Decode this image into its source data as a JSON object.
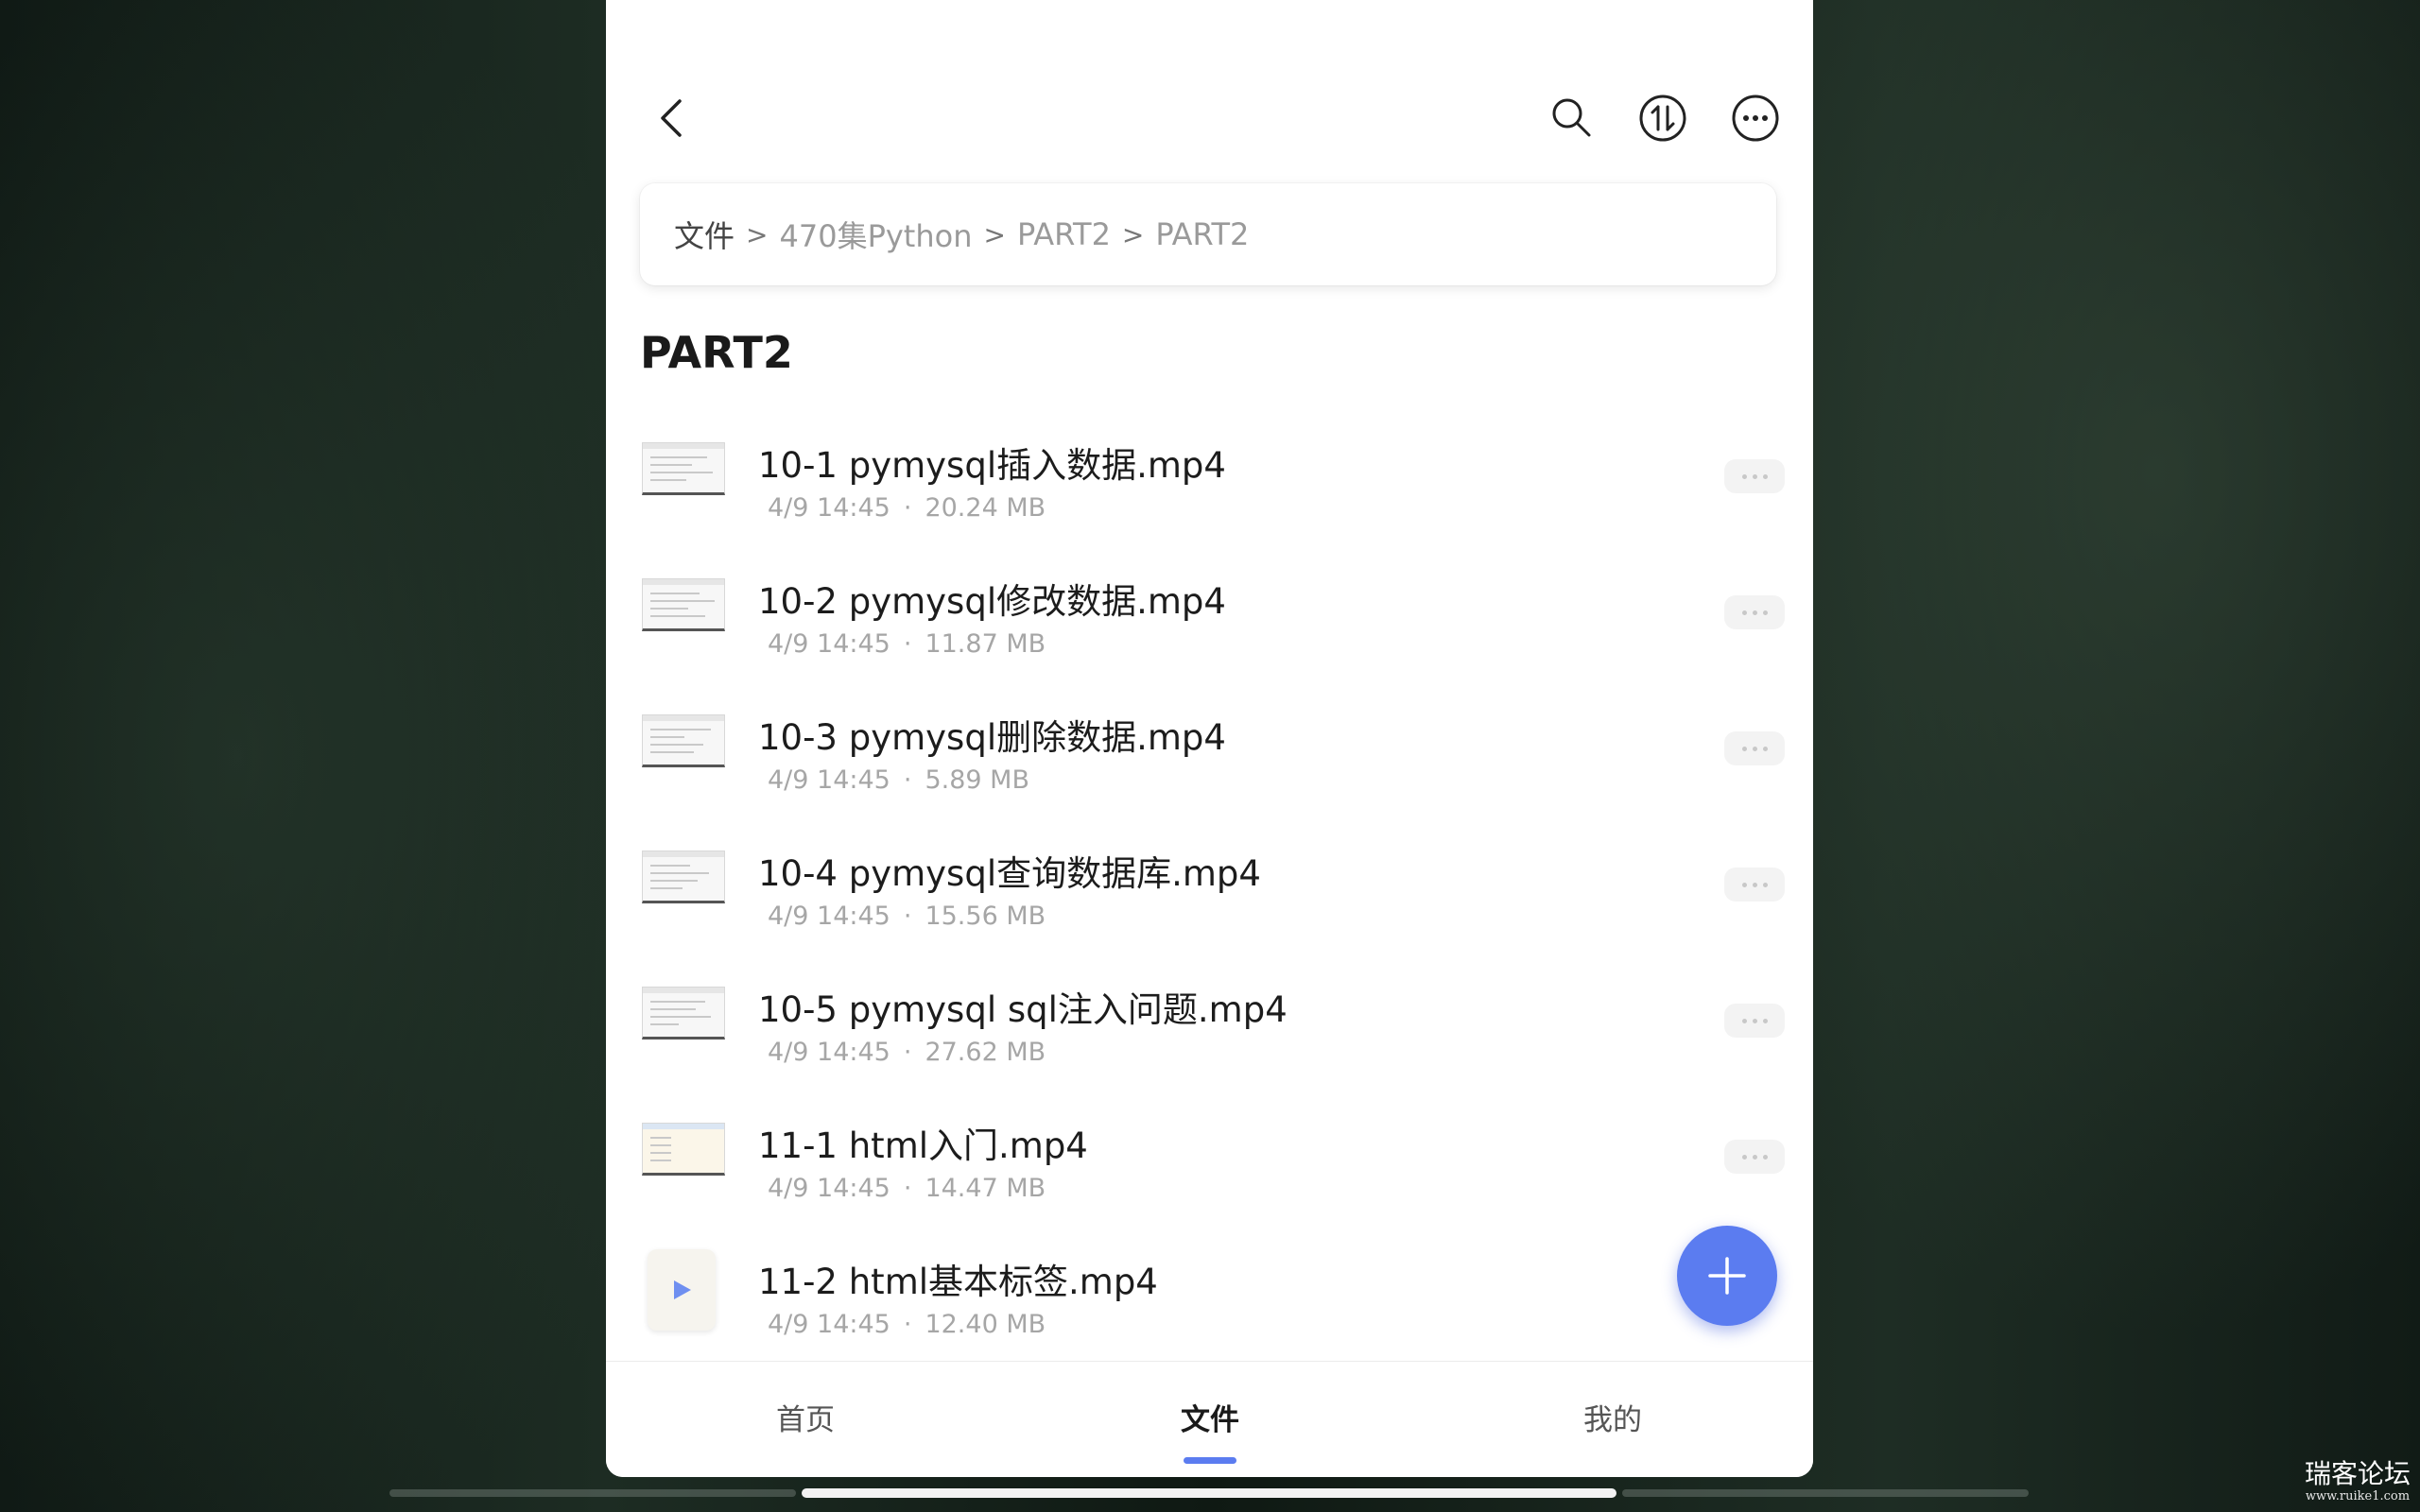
{
  "header": {
    "back_icon": "chevron-left-icon",
    "search_icon": "search-icon",
    "sort_icon": "sort-updown-icon",
    "more_icon": "more-horizontal-icon"
  },
  "breadcrumb": {
    "items": [
      "文件",
      "470集Python",
      "PART2",
      "PART2"
    ],
    "separator": ">"
  },
  "page_title": "PART2",
  "files": [
    {
      "name": "10-1 pymysql插入数据.mp4",
      "date": "4/9 14:45",
      "size": "20.24 MB",
      "thumb": "screenshot"
    },
    {
      "name": "10-2 pymysql修改数据.mp4",
      "date": "4/9 14:45",
      "size": "11.87 MB",
      "thumb": "screenshot"
    },
    {
      "name": "10-3 pymysql删除数据.mp4",
      "date": "4/9 14:45",
      "size": "5.89 MB",
      "thumb": "screenshot"
    },
    {
      "name": "10-4 pymysql查询数据库.mp4",
      "date": "4/9 14:45",
      "size": "15.56 MB",
      "thumb": "screenshot"
    },
    {
      "name": "10-5 pymysql sql注入问题.mp4",
      "date": "4/9 14:45",
      "size": "27.62 MB",
      "thumb": "screenshot"
    },
    {
      "name": "11-1 html入门.mp4",
      "date": "4/9 14:45",
      "size": "14.47 MB",
      "thumb": "screenshot-warm"
    },
    {
      "name": "11-2 html基本标签.mp4",
      "date": "4/9 14:45",
      "size": "12.40 MB",
      "thumb": "video-icon"
    }
  ],
  "meta_separator": "·",
  "fab": {
    "icon": "plus-icon"
  },
  "bottom_nav": {
    "items": [
      {
        "label": "首页"
      },
      {
        "label": "文件"
      },
      {
        "label": "我的"
      }
    ],
    "active": "文件"
  },
  "watermark": {
    "title": "瑞客论坛",
    "url": "www.ruike1.com"
  },
  "colors": {
    "accent": "#5b7cf0",
    "background": "#14201a",
    "panel": "#ffffff",
    "meta_text": "#a6a6a6"
  }
}
